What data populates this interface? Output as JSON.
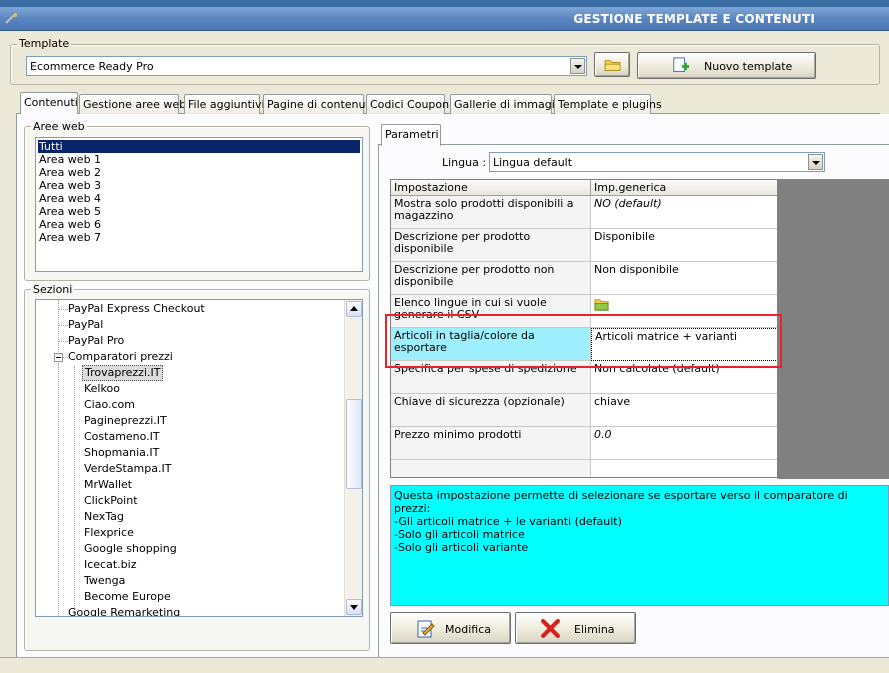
{
  "window": {
    "title": "GESTIONE TEMPLATE E CONTENUTI"
  },
  "template": {
    "group_label": "Template",
    "selected": "Ecommerce Ready Pro",
    "new_button": "Nuovo template"
  },
  "tabs": [
    "Contenuti",
    "Gestione aree web",
    "File aggiuntivi",
    "Pagine di contenuti",
    "Codici Coupon",
    "Gallerie di immagini",
    "Template e plugins"
  ],
  "aree_web": {
    "label": "Aree web",
    "items": [
      "Tutti",
      "Area web 1",
      "Area web 2",
      "Area web 3",
      "Area web 4",
      "Area web 5",
      "Area web 6",
      "Area web 7"
    ]
  },
  "sezioni": {
    "label": "Sezioni",
    "items": [
      "PayPal Express Checkout",
      "PayPal",
      "PayPal Pro",
      "Comparatori prezzi",
      "Trovaprezzi.IT",
      "Kelkoo",
      "Ciao.com",
      "Pagineprezzi.IT",
      "Costameno.IT",
      "Shopmania.IT",
      "VerdeStampa.IT",
      "MrWallet",
      "ClickPoint",
      "NexTag",
      "Flexprice",
      "Google shopping",
      "Icecat.biz",
      "Twenga",
      "Become Europe",
      "Google Remarketing"
    ]
  },
  "params": {
    "tab": "Parametri",
    "lingua_label": "Lingua :",
    "lingua_value": "Lingua default",
    "col_setting": "Impostazione",
    "col_value": "Imp.generica",
    "rows": [
      {
        "name": "Mostra solo prodotti disponibili a magazzino",
        "value": "NO (default)"
      },
      {
        "name": "Descrizione per prodotto disponibile",
        "value": "Disponibile"
      },
      {
        "name": "Descrizione per prodotto non disponibile",
        "value": "Non disponibile"
      },
      {
        "name": "Elenco lingue in cui si vuole generare il CSV",
        "value": ""
      },
      {
        "name": "Articoli in taglia/colore da esportare",
        "value": "Articoli matrice + varianti"
      },
      {
        "name": "Specifica per spese di spedizione",
        "value": "Non calcolate (default)"
      },
      {
        "name": "Chiave di sicurezza (opzionale)",
        "value": "chiave"
      },
      {
        "name": "Prezzo minimo prodotti",
        "value": "0.0"
      }
    ],
    "info_lines": [
      "Questa impostazione permette di selezionare se esportare verso il comparatore di prezzi:",
      "-Gli articoli matrice + le varianti (default)",
      "-Solo gli articoli matrice",
      "-Solo gli articoli variante"
    ],
    "modify_button": "Modifica",
    "delete_button": "Elimina"
  },
  "colors": {
    "highlight_box": "#e8232b",
    "info_bg": "#00ffff",
    "selected_row_bg": "#9ff0ff"
  }
}
